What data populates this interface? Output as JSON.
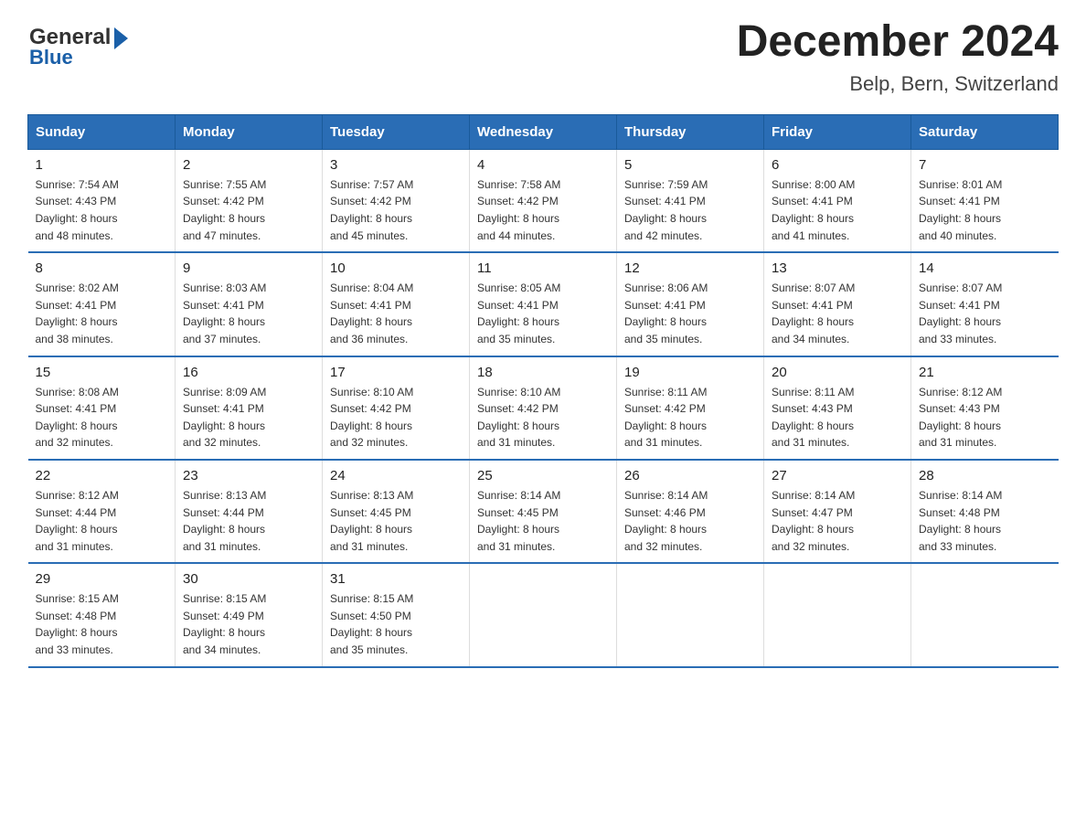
{
  "logo": {
    "general": "General",
    "blue": "Blue"
  },
  "title": {
    "month_year": "December 2024",
    "location": "Belp, Bern, Switzerland"
  },
  "headers": [
    "Sunday",
    "Monday",
    "Tuesday",
    "Wednesday",
    "Thursday",
    "Friday",
    "Saturday"
  ],
  "weeks": [
    [
      {
        "day": "1",
        "sunrise": "7:54 AM",
        "sunset": "4:43 PM",
        "daylight": "8 hours and 48 minutes."
      },
      {
        "day": "2",
        "sunrise": "7:55 AM",
        "sunset": "4:42 PM",
        "daylight": "8 hours and 47 minutes."
      },
      {
        "day": "3",
        "sunrise": "7:57 AM",
        "sunset": "4:42 PM",
        "daylight": "8 hours and 45 minutes."
      },
      {
        "day": "4",
        "sunrise": "7:58 AM",
        "sunset": "4:42 PM",
        "daylight": "8 hours and 44 minutes."
      },
      {
        "day": "5",
        "sunrise": "7:59 AM",
        "sunset": "4:41 PM",
        "daylight": "8 hours and 42 minutes."
      },
      {
        "day": "6",
        "sunrise": "8:00 AM",
        "sunset": "4:41 PM",
        "daylight": "8 hours and 41 minutes."
      },
      {
        "day": "7",
        "sunrise": "8:01 AM",
        "sunset": "4:41 PM",
        "daylight": "8 hours and 40 minutes."
      }
    ],
    [
      {
        "day": "8",
        "sunrise": "8:02 AM",
        "sunset": "4:41 PM",
        "daylight": "8 hours and 38 minutes."
      },
      {
        "day": "9",
        "sunrise": "8:03 AM",
        "sunset": "4:41 PM",
        "daylight": "8 hours and 37 minutes."
      },
      {
        "day": "10",
        "sunrise": "8:04 AM",
        "sunset": "4:41 PM",
        "daylight": "8 hours and 36 minutes."
      },
      {
        "day": "11",
        "sunrise": "8:05 AM",
        "sunset": "4:41 PM",
        "daylight": "8 hours and 35 minutes."
      },
      {
        "day": "12",
        "sunrise": "8:06 AM",
        "sunset": "4:41 PM",
        "daylight": "8 hours and 35 minutes."
      },
      {
        "day": "13",
        "sunrise": "8:07 AM",
        "sunset": "4:41 PM",
        "daylight": "8 hours and 34 minutes."
      },
      {
        "day": "14",
        "sunrise": "8:07 AM",
        "sunset": "4:41 PM",
        "daylight": "8 hours and 33 minutes."
      }
    ],
    [
      {
        "day": "15",
        "sunrise": "8:08 AM",
        "sunset": "4:41 PM",
        "daylight": "8 hours and 32 minutes."
      },
      {
        "day": "16",
        "sunrise": "8:09 AM",
        "sunset": "4:41 PM",
        "daylight": "8 hours and 32 minutes."
      },
      {
        "day": "17",
        "sunrise": "8:10 AM",
        "sunset": "4:42 PM",
        "daylight": "8 hours and 32 minutes."
      },
      {
        "day": "18",
        "sunrise": "8:10 AM",
        "sunset": "4:42 PM",
        "daylight": "8 hours and 31 minutes."
      },
      {
        "day": "19",
        "sunrise": "8:11 AM",
        "sunset": "4:42 PM",
        "daylight": "8 hours and 31 minutes."
      },
      {
        "day": "20",
        "sunrise": "8:11 AM",
        "sunset": "4:43 PM",
        "daylight": "8 hours and 31 minutes."
      },
      {
        "day": "21",
        "sunrise": "8:12 AM",
        "sunset": "4:43 PM",
        "daylight": "8 hours and 31 minutes."
      }
    ],
    [
      {
        "day": "22",
        "sunrise": "8:12 AM",
        "sunset": "4:44 PM",
        "daylight": "8 hours and 31 minutes."
      },
      {
        "day": "23",
        "sunrise": "8:13 AM",
        "sunset": "4:44 PM",
        "daylight": "8 hours and 31 minutes."
      },
      {
        "day": "24",
        "sunrise": "8:13 AM",
        "sunset": "4:45 PM",
        "daylight": "8 hours and 31 minutes."
      },
      {
        "day": "25",
        "sunrise": "8:14 AM",
        "sunset": "4:45 PM",
        "daylight": "8 hours and 31 minutes."
      },
      {
        "day": "26",
        "sunrise": "8:14 AM",
        "sunset": "4:46 PM",
        "daylight": "8 hours and 32 minutes."
      },
      {
        "day": "27",
        "sunrise": "8:14 AM",
        "sunset": "4:47 PM",
        "daylight": "8 hours and 32 minutes."
      },
      {
        "day": "28",
        "sunrise": "8:14 AM",
        "sunset": "4:48 PM",
        "daylight": "8 hours and 33 minutes."
      }
    ],
    [
      {
        "day": "29",
        "sunrise": "8:15 AM",
        "sunset": "4:48 PM",
        "daylight": "8 hours and 33 minutes."
      },
      {
        "day": "30",
        "sunrise": "8:15 AM",
        "sunset": "4:49 PM",
        "daylight": "8 hours and 34 minutes."
      },
      {
        "day": "31",
        "sunrise": "8:15 AM",
        "sunset": "4:50 PM",
        "daylight": "8 hours and 35 minutes."
      },
      null,
      null,
      null,
      null
    ]
  ],
  "labels": {
    "sunrise": "Sunrise:",
    "sunset": "Sunset:",
    "daylight": "Daylight:"
  }
}
